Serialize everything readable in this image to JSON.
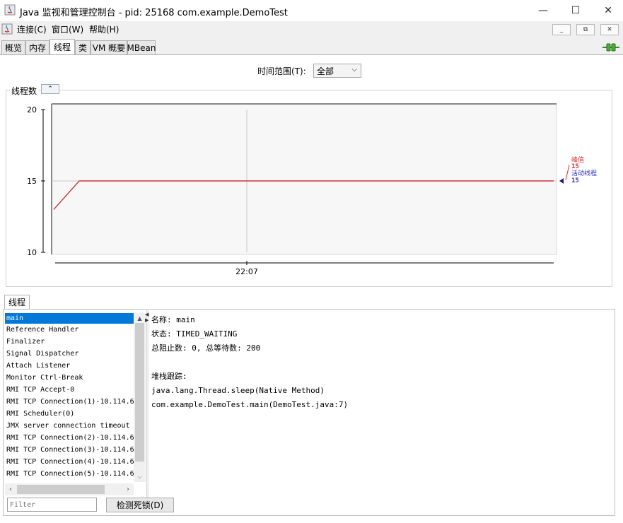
{
  "window": {
    "title": "Java 监视和管理控制台 - pid: 25168 com.example.DemoTest",
    "minimize": "—",
    "maximize": "☐",
    "close": "✕"
  },
  "menu": {
    "items": [
      "连接(C)",
      "窗口(W)",
      "帮助(H)"
    ],
    "mdi": [
      "_",
      "⧉",
      "✕"
    ]
  },
  "tabs": [
    "概览",
    "内存",
    "线程",
    "类",
    "VM 概要",
    "MBean"
  ],
  "active_tab": "线程",
  "time_range": {
    "label": "时间范围(T):",
    "value": "全部"
  },
  "chart_panel": {
    "title": "线程数",
    "collapse": "⌃"
  },
  "chart_data": {
    "type": "line",
    "ylim": [
      10,
      20
    ],
    "yticks": [
      "20",
      "15",
      "10"
    ],
    "xticks": [
      "22:07"
    ],
    "series": [
      {
        "name": "峰值",
        "values": [
          13,
          15,
          15,
          15
        ],
        "current": "15",
        "color": "#e03030"
      },
      {
        "name": "活动线程",
        "values": [
          13,
          15,
          15,
          15
        ],
        "current": "15",
        "color": "#3030c0"
      }
    ]
  },
  "threads": {
    "tab_label": "线程",
    "list": [
      "main",
      "Reference Handler",
      "Finalizer",
      "Signal Dispatcher",
      "Attach Listener",
      "Monitor Ctrl-Break",
      "RMI TCP Accept-0",
      "RMI TCP Connection(1)-10.114.6",
      "RMI Scheduler(0)",
      "JMX server connection timeout",
      "RMI TCP Connection(2)-10.114.6",
      "RMI TCP Connection(3)-10.114.6",
      "RMI TCP Connection(4)-10.114.6",
      "RMI TCP Connection(5)-10.114.6"
    ],
    "selected": "main",
    "details": {
      "name_line": "名称: main",
      "state_line": "状态: TIMED_WAITING",
      "counts_line": "总阻止数: 0, 总等待数: 200",
      "stack_label": "堆栈跟踪:",
      "stack": [
        "java.lang.Thread.sleep(Native Method)",
        "com.example.DemoTest.main(DemoTest.java:7)"
      ]
    },
    "filter_placeholder": "Filter",
    "deadlock_button": "检测死锁(D)"
  }
}
